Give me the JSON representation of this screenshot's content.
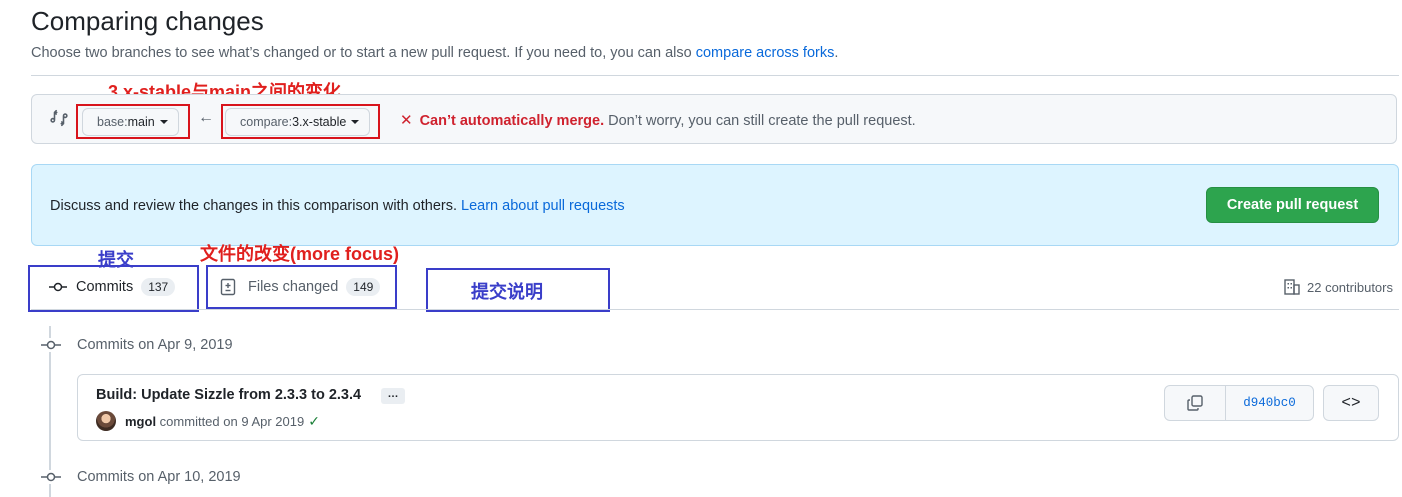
{
  "header": {
    "title": "Comparing changes",
    "subtitle_prefix": "Choose two branches to see what’s changed or to start a new pull request. If you need to, you can also ",
    "subtitle_link": "compare across forks",
    "subtitle_suffix": "."
  },
  "annotations": {
    "branches_note": "3.x-stable与main之间的变化",
    "commits_note": "提交",
    "files_note": "文件的改变(more focus)",
    "description_note": "提交说明"
  },
  "range": {
    "base_label": "base: ",
    "base_value": "main",
    "compare_label": "compare: ",
    "compare_value": "3.x-stable",
    "merge_status_bad": "Can’t automatically merge.",
    "merge_status_hint": "Don’t worry, you can still create the pull request."
  },
  "flash": {
    "text": "Discuss and review the changes in this comparison with others. ",
    "link": "Learn about pull requests",
    "create_button": "Create pull request"
  },
  "tabs": {
    "commits_label": "Commits",
    "commits_count": "137",
    "files_label": "Files changed",
    "files_count": "149"
  },
  "contributors": "22 contributors",
  "timeline": {
    "groups": [
      {
        "date_label": "Commits on Apr 9, 2019"
      },
      {
        "date_label": "Commits on Apr 10, 2019"
      }
    ]
  },
  "commit": {
    "message": "Build: Update Sizzle from 2.3.3 to 2.3.4",
    "ellipsis": "…",
    "author": "mgol",
    "meta": " committed on 9 Apr 2019",
    "sha": "d940bc0",
    "browse": "<>"
  },
  "colors": {
    "annotation_red": "#e0201e",
    "annotation_blue": "#3a3ec9",
    "primary_green": "#2da44e",
    "link_blue": "#0969da",
    "danger_red": "#cf222e"
  },
  "icons": [
    "git-compare-icon",
    "arrow-left-icon",
    "x-icon",
    "git-commit-icon",
    "file-diff-icon",
    "organization-icon",
    "copy-icon",
    "check-icon",
    "code-icon"
  ]
}
